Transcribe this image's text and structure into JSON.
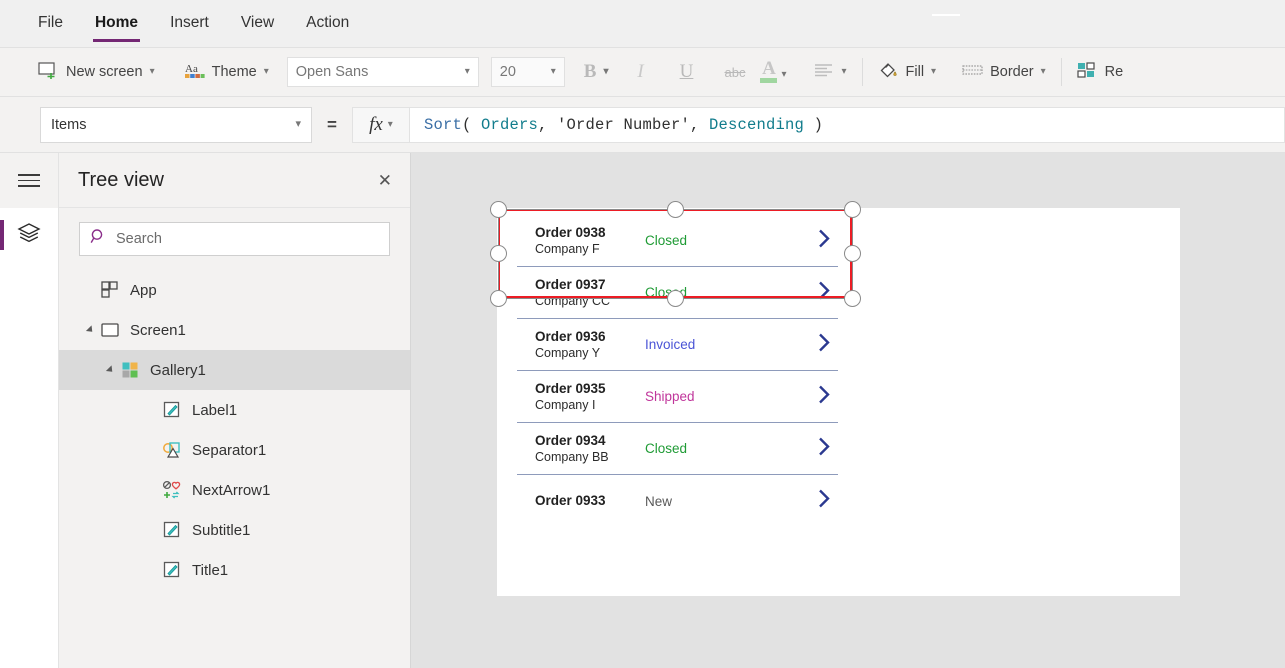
{
  "menu": {
    "items": [
      {
        "label": "File",
        "active": false
      },
      {
        "label": "Home",
        "active": true
      },
      {
        "label": "Insert",
        "active": false
      },
      {
        "label": "View",
        "active": false
      },
      {
        "label": "Action",
        "active": false
      }
    ]
  },
  "ribbon": {
    "new_screen": {
      "label": "New screen",
      "icon": "new-screen-icon"
    },
    "theme": {
      "label": "Theme",
      "icon": "theme-icon"
    },
    "font_name": "Open Sans",
    "font_size": "20",
    "bold": "B",
    "italic": "I",
    "underline": "U",
    "strikethrough": "abc",
    "font_color": {
      "label": "A",
      "color": "#a0d6a0"
    },
    "align": {
      "icon": "align-icon"
    },
    "fill": {
      "label": "Fill",
      "icon": "fill-bucket-icon"
    },
    "border": {
      "label": "Border",
      "icon": "border-icon"
    },
    "reorder": {
      "label": "Re",
      "icon": "reorder-icon"
    }
  },
  "formula_bar": {
    "property": "Items",
    "equals": "=",
    "fx": "fx",
    "formula_tokens": [
      {
        "text": "Sort",
        "type": "fn"
      },
      {
        "text": "( ",
        "type": "punc"
      },
      {
        "text": "Orders",
        "type": "src"
      },
      {
        "text": ", ",
        "type": "punc"
      },
      {
        "text": "'Order Number'",
        "type": "str"
      },
      {
        "text": ", ",
        "type": "punc"
      },
      {
        "text": "Descending",
        "type": "src"
      },
      {
        "text": " )",
        "type": "punc"
      }
    ],
    "formula_text": "Sort( Orders, 'Order Number', Descending )"
  },
  "rail": {
    "menu_icon": "hamburger-icon",
    "layers_icon": "layers-icon",
    "accent": "#742774"
  },
  "tree": {
    "title": "Tree view",
    "close": "✕",
    "search_placeholder": "Search",
    "items": [
      {
        "label": "App",
        "indent": 1,
        "icon": "app-icon",
        "twisty": false,
        "selected": false
      },
      {
        "label": "Screen1",
        "indent": 1,
        "icon": "screen-icon",
        "twisty": true,
        "selected": false
      },
      {
        "label": "Gallery1",
        "indent": 2,
        "icon": "gallery-icon",
        "twisty": true,
        "selected": true
      },
      {
        "label": "Label1",
        "indent": 3,
        "icon": "label-icon",
        "twisty": false,
        "selected": false
      },
      {
        "label": "Separator1",
        "indent": 3,
        "icon": "separator-icon",
        "twisty": false,
        "selected": false
      },
      {
        "label": "NextArrow1",
        "indent": 3,
        "icon": "nextarrow-icon",
        "twisty": false,
        "selected": false
      },
      {
        "label": "Subtitle1",
        "indent": 3,
        "icon": "label-icon",
        "twisty": false,
        "selected": false
      },
      {
        "label": "Title1",
        "indent": 3,
        "icon": "label-icon",
        "twisty": false,
        "selected": false
      }
    ]
  },
  "canvas": {
    "gallery_rows": [
      {
        "title": "Order 0938",
        "subtitle": "Company F",
        "status": "Closed",
        "status_color": "#1f9b35",
        "arrow": "chevron-right-icon"
      },
      {
        "title": "Order 0937",
        "subtitle": "Company CC",
        "status": "Closed",
        "status_color": "#1f9b35",
        "arrow": "chevron-right-icon"
      },
      {
        "title": "Order 0936",
        "subtitle": "Company Y",
        "status": "Invoiced",
        "status_color": "#4a54d6",
        "arrow": "chevron-right-icon"
      },
      {
        "title": "Order 0935",
        "subtitle": "Company I",
        "status": "Shipped",
        "status_color": "#c0369b",
        "arrow": "chevron-right-icon"
      },
      {
        "title": "Order 0934",
        "subtitle": "Company BB",
        "status": "Closed",
        "status_color": "#1f9b35",
        "arrow": "chevron-right-icon"
      },
      {
        "title": "Order 0933",
        "subtitle": "",
        "status": "New",
        "status_color": "#595959",
        "arrow": "chevron-right-icon"
      }
    ],
    "selection_color": "#ec1c24",
    "arrow_color": "#2b3990",
    "separator_color": "#8e9bbb"
  }
}
